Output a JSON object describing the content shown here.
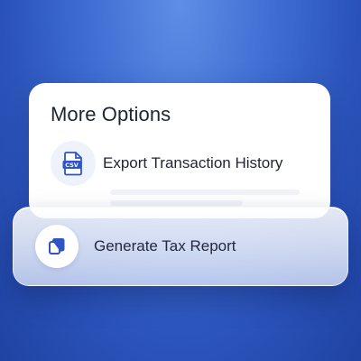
{
  "panel": {
    "title": "More Options",
    "items": [
      {
        "label": "Export Transaction History",
        "icon": "csv-file-icon"
      },
      {
        "label": "Generate Tax Report",
        "icon": "copy-documents-icon"
      }
    ]
  },
  "colors": {
    "accent": "#2f54c7",
    "background": "#3f6fd3"
  }
}
